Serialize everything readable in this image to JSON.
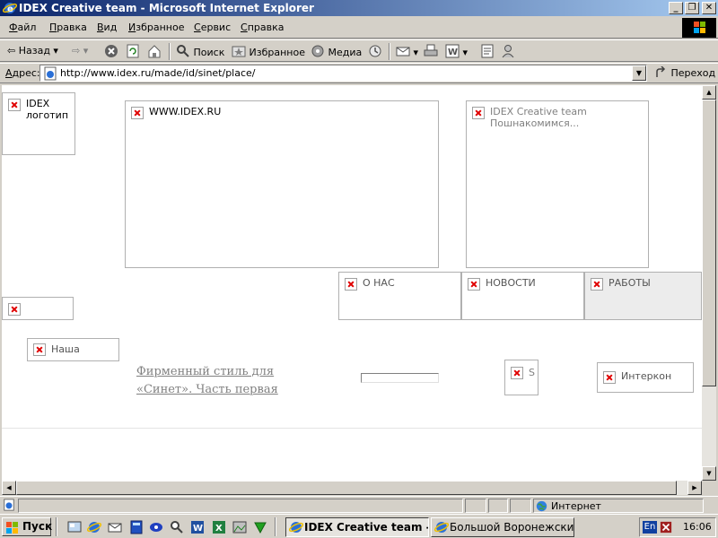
{
  "window": {
    "title": "IDEX Creative team - Microsoft Internet Explorer",
    "buttons": [
      "_",
      "❐",
      "✕"
    ]
  },
  "menu": [
    "Файл",
    "Правка",
    "Вид",
    "Избранное",
    "Сервис",
    "Справка"
  ],
  "toolbar": {
    "back": "Назад",
    "search": "Поиск",
    "favorites": "Избранное",
    "media": "Медиа"
  },
  "address": {
    "label": "Адрес:",
    "url": "http://www.idex.ru/made/id/sinet/place/",
    "go": "Переход"
  },
  "page": {
    "logo_alt": "IDEX\nлоготип",
    "header_alt": "WWW.IDEX.RU",
    "team_alt": "IDEX Creative team\nПошнакомимся...",
    "nav": {
      "about": "О НАС",
      "news": "НОВОСТИ",
      "works": "РАБОТЫ"
    },
    "left_alt": "Наша",
    "link_text": "Фирменный стиль для\n«Синет». Часть первая",
    "right_small_alt": "S",
    "partner_alt": "Интеркон"
  },
  "status": {
    "zone": "Интернет"
  },
  "taskbar": {
    "start": "Пуск",
    "tasks": [
      "IDEX Creative team - ...",
      "Большой Воронежский ..."
    ],
    "lang": "En",
    "clock": "16:06"
  }
}
